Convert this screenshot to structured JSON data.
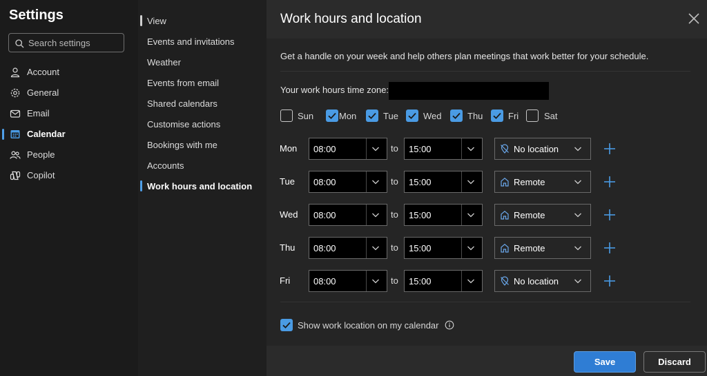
{
  "left": {
    "title": "Settings",
    "search_placeholder": "Search settings",
    "items": [
      {
        "label": "Account",
        "icon": "person-icon"
      },
      {
        "label": "General",
        "icon": "gear-icon"
      },
      {
        "label": "Email",
        "icon": "mail-icon"
      },
      {
        "label": "Calendar",
        "icon": "calendar-icon"
      },
      {
        "label": "People",
        "icon": "people-icon"
      },
      {
        "label": "Copilot",
        "icon": "copilot-icon"
      }
    ],
    "active_index": 3
  },
  "middle": {
    "items": [
      "View",
      "Events and invitations",
      "Weather",
      "Events from email",
      "Shared calendars",
      "Customise actions",
      "Bookings with me",
      "Accounts",
      "Work hours and location"
    ],
    "active_index": 8
  },
  "panel": {
    "title": "Work hours and location",
    "description": "Get a handle on your week and help others plan meetings that work better for your schedule.",
    "timezone_label": "Your work hours time zone:",
    "days": [
      {
        "label": "Sun",
        "checked": false
      },
      {
        "label": "Mon",
        "checked": true
      },
      {
        "label": "Tue",
        "checked": true
      },
      {
        "label": "Wed",
        "checked": true
      },
      {
        "label": "Thu",
        "checked": true
      },
      {
        "label": "Fri",
        "checked": true
      },
      {
        "label": "Sat",
        "checked": false
      }
    ],
    "rows": [
      {
        "day": "Mon",
        "start": "08:00",
        "to": "to",
        "end": "15:00",
        "location": "No location",
        "location_icon": "no-location-icon"
      },
      {
        "day": "Tue",
        "start": "08:00",
        "to": "to",
        "end": "15:00",
        "location": "Remote",
        "location_icon": "home-icon"
      },
      {
        "day": "Wed",
        "start": "08:00",
        "to": "to",
        "end": "15:00",
        "location": "Remote",
        "location_icon": "home-icon"
      },
      {
        "day": "Thu",
        "start": "08:00",
        "to": "to",
        "end": "15:00",
        "location": "Remote",
        "location_icon": "home-icon"
      },
      {
        "day": "Fri",
        "start": "08:00",
        "to": "to",
        "end": "15:00",
        "location": "No location",
        "location_icon": "no-location-icon"
      }
    ],
    "show_location_label": "Show work location on my calendar",
    "show_location_checked": true,
    "save_label": "Save",
    "discard_label": "Discard"
  },
  "colors": {
    "accent": "#4a9be4",
    "primary_button": "#2f7dd4",
    "background": "#1f1f1f",
    "panel_background": "#252525"
  }
}
